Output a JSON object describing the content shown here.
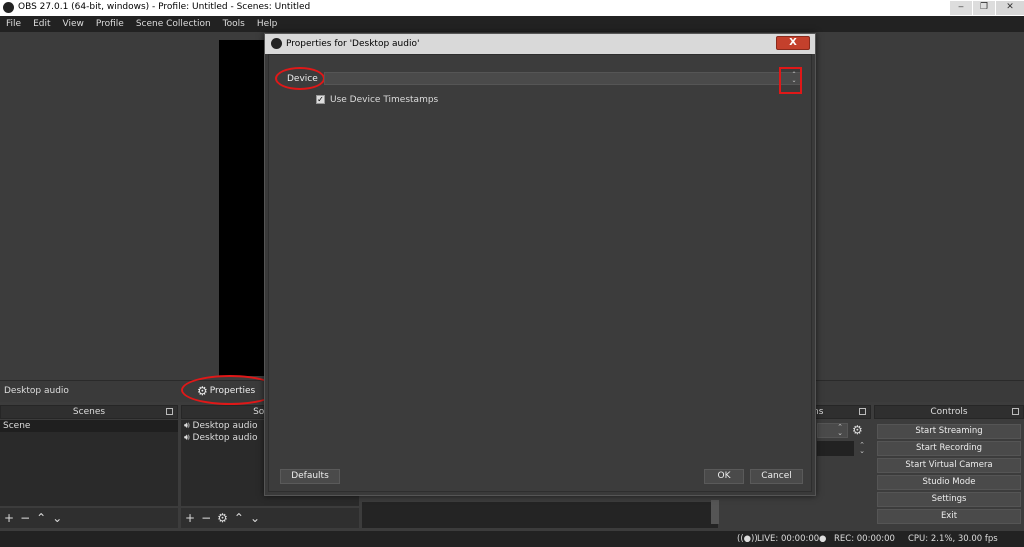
{
  "window": {
    "title": "OBS 27.0.1 (64-bit, windows) - Profile: Untitled - Scenes: Untitled",
    "buttons": [
      "‒",
      "❐",
      "✕"
    ]
  },
  "menu": [
    "File",
    "Edit",
    "View",
    "Profile",
    "Scene Collection",
    "Tools",
    "Help"
  ],
  "sourcebar": {
    "source_name": "Desktop audio",
    "properties_label": "Properties"
  },
  "docks": {
    "scenes": {
      "title": "Scenes",
      "items": [
        "Scene"
      ]
    },
    "sources": {
      "title": "Sou",
      "items": [
        "Desktop audio",
        "Desktop audio"
      ]
    },
    "transitions": {
      "title": "ns"
    },
    "controls": {
      "title": "Controls",
      "buttons": [
        "Start Streaming",
        "Start Recording",
        "Start Virtual Camera",
        "Studio Mode",
        "Settings",
        "Exit"
      ]
    }
  },
  "status": {
    "live": "LIVE: 00:00:00",
    "rec": "REC: 00:00:00",
    "cpu": "CPU: 2.1%, 30.00 fps"
  },
  "dialog": {
    "title": "Properties for 'Desktop audio'",
    "close": "X",
    "device_label": "Device",
    "device_value": "",
    "timestamps_label": "Use Device Timestamps",
    "timestamps_checked": true,
    "defaults_label": "Defaults",
    "ok_label": "OK",
    "cancel_label": "Cancel"
  },
  "colors": {
    "annotation": "#e01818",
    "background": "#3c3c3c",
    "close_button": "#c4402c"
  }
}
